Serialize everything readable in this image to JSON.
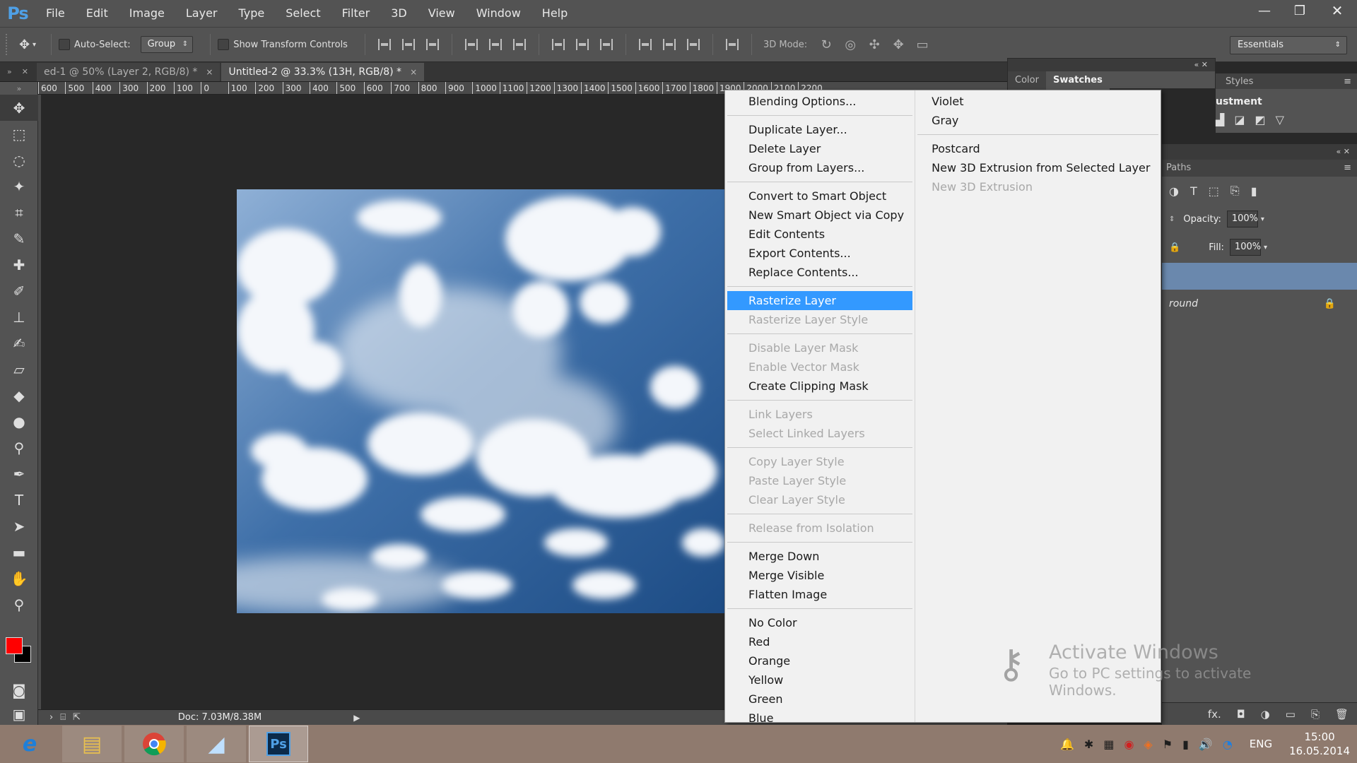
{
  "app": {
    "logo": "Ps"
  },
  "menubar": {
    "items": [
      "File",
      "Edit",
      "Image",
      "Layer",
      "Type",
      "Select",
      "Filter",
      "3D",
      "View",
      "Window",
      "Help"
    ],
    "window_controls": [
      "—",
      "❐",
      "✕"
    ]
  },
  "options": {
    "auto_select_label": "Auto-Select:",
    "auto_select_value": "Group",
    "show_transform_label": "Show Transform Controls",
    "mode3d_label": "3D Mode:",
    "workspace": "Essentials"
  },
  "tabs": {
    "left_arrows": "»",
    "items": [
      {
        "label": "ed-1 @ 50% (Layer 2, RGB/8) *",
        "close": "×",
        "active": false
      },
      {
        "label": "Untitled-2 @ 33.3% (13H, RGB/8) *",
        "close": "×",
        "active": true
      }
    ]
  },
  "ruler": {
    "ticks": [
      "600",
      "500",
      "400",
      "300",
      "200",
      "100",
      "0",
      "100",
      "200",
      "300",
      "400",
      "500",
      "600",
      "700",
      "800",
      "900",
      "1000",
      "1100",
      "1200",
      "1300",
      "1400",
      "1500",
      "1600",
      "1700",
      "1800",
      "1900",
      "2000",
      "2100",
      "2200"
    ]
  },
  "status": {
    "doc": "Doc: 7.03M/8.38M"
  },
  "colors": {
    "foreground": "#ff0000",
    "background": "#000000",
    "highlight": "#3399ff"
  },
  "panels": {
    "color_tabs": [
      "Color",
      "Swatches"
    ],
    "styles_tabs": [
      "Styles"
    ],
    "adjustments_title": "ustment",
    "layers_tabs": [
      "Paths"
    ],
    "opacity_label": "Opacity:",
    "opacity_value": "100%",
    "fill_label": "Fill:",
    "fill_value": "100%",
    "background_layer": "round"
  },
  "context_menu": {
    "col1": [
      {
        "label": "Blending Options...",
        "state": "normal"
      },
      {
        "sep": true
      },
      {
        "label": "Duplicate Layer...",
        "state": "normal"
      },
      {
        "label": "Delete Layer",
        "state": "normal"
      },
      {
        "label": "Group from Layers...",
        "state": "normal"
      },
      {
        "sep": true
      },
      {
        "label": "Convert to Smart Object",
        "state": "normal"
      },
      {
        "label": "New Smart Object via Copy",
        "state": "normal"
      },
      {
        "label": "Edit Contents",
        "state": "normal"
      },
      {
        "label": "Export Contents...",
        "state": "normal"
      },
      {
        "label": "Replace Contents...",
        "state": "normal"
      },
      {
        "sep": true
      },
      {
        "label": "Rasterize Layer",
        "state": "highlighted"
      },
      {
        "label": "Rasterize Layer Style",
        "state": "disabled"
      },
      {
        "sep": true
      },
      {
        "label": "Disable Layer Mask",
        "state": "disabled"
      },
      {
        "label": "Enable Vector Mask",
        "state": "disabled"
      },
      {
        "label": "Create Clipping Mask",
        "state": "normal"
      },
      {
        "sep": true
      },
      {
        "label": "Link Layers",
        "state": "disabled"
      },
      {
        "label": "Select Linked Layers",
        "state": "disabled"
      },
      {
        "sep": true
      },
      {
        "label": "Copy Layer Style",
        "state": "disabled"
      },
      {
        "label": "Paste Layer Style",
        "state": "disabled"
      },
      {
        "label": "Clear Layer Style",
        "state": "disabled"
      },
      {
        "sep": true
      },
      {
        "label": "Release from Isolation",
        "state": "disabled"
      },
      {
        "sep": true
      },
      {
        "label": "Merge Down",
        "state": "normal"
      },
      {
        "label": "Merge Visible",
        "state": "normal"
      },
      {
        "label": "Flatten Image",
        "state": "normal"
      },
      {
        "sep": true
      },
      {
        "label": "No Color",
        "state": "normal"
      },
      {
        "label": "Red",
        "state": "normal"
      },
      {
        "label": "Orange",
        "state": "normal"
      },
      {
        "label": "Yellow",
        "state": "normal"
      },
      {
        "label": "Green",
        "state": "normal"
      },
      {
        "label": "Blue",
        "state": "normal"
      }
    ],
    "col2": [
      {
        "label": "Violet",
        "state": "normal"
      },
      {
        "label": "Gray",
        "state": "normal"
      },
      {
        "sep": true
      },
      {
        "label": "Postcard",
        "state": "normal"
      },
      {
        "label": "New 3D Extrusion from Selected Layer",
        "state": "normal"
      },
      {
        "label": "New 3D Extrusion",
        "state": "disabled"
      }
    ]
  },
  "watermark": {
    "line1": "Activate Windows",
    "line2": "Go to PC settings to activate Windows."
  },
  "taskbar": {
    "lang": "ENG",
    "time": "15:00",
    "date": "16.05.2014"
  }
}
